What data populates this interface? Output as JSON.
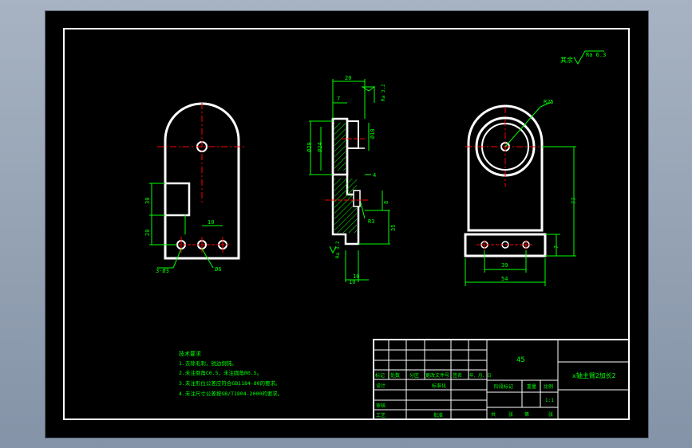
{
  "colors": {
    "background": "#000000",
    "outline": "#ffffff",
    "dimension": "#00ff00",
    "centerline": "#ff0000",
    "hatch": "#00ff00",
    "text": "#00ff00"
  },
  "roughness": {
    "prefix": "其余",
    "value": "Ra 6.3"
  },
  "front_view": {
    "dims": [
      "30",
      "20",
      "10",
      "3-Ø3",
      "Ø6"
    ]
  },
  "side_view": {
    "dims": [
      "20",
      "7",
      "Ø20",
      "Ø24",
      "Ø10",
      "8",
      "4",
      "10",
      "R3",
      "35",
      "Ra 3.2",
      "Ra 3.2",
      "10"
    ]
  },
  "right_view": {
    "dims": [
      "R25",
      "77",
      "7",
      "39",
      "54"
    ]
  },
  "tech_requirements": {
    "title": "技术要求",
    "lines": [
      "1.去除毛刺，锐边倒钝。",
      "2.未注倒角C0.5，未注圆角R0.5。",
      "3.未注形位公差应符合GB1184-80的要求。",
      "4.未注尺寸公差按GB/T1804-2000的要求。"
    ]
  },
  "title_block": {
    "material": "45",
    "part_name": "x轴主臂2加长2",
    "labels": {
      "mark": "标记",
      "count": "处数",
      "zone": "分区",
      "change_doc": "更改文件号",
      "signature": "签名",
      "date": "年、月、日",
      "designer": "设计",
      "standardization": "标准化",
      "stage_marking": "阶段标记",
      "weight": "重量",
      "scale": "比例",
      "reviewer": "审核",
      "process": "工艺",
      "approval": "批准",
      "sheet_total": "共",
      "sheet_of": "张",
      "sheet_no": "第",
      "sheet_end": "张"
    },
    "scale_value": "1:1"
  }
}
